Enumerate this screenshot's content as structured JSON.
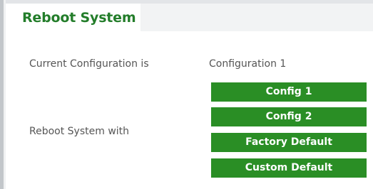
{
  "tab": {
    "title": "Reboot System"
  },
  "current_config": {
    "label": "Current Configuration is",
    "value": "Configuration 1"
  },
  "reboot": {
    "label": "Reboot System with",
    "buttons": [
      {
        "label": "Config 1"
      },
      {
        "label": "Config 2"
      },
      {
        "label": "Factory Default"
      },
      {
        "label": "Custom Default"
      }
    ]
  },
  "colors": {
    "accent_green": "#2a8e25",
    "title_green": "#237d2a",
    "text_gray": "#555555"
  }
}
